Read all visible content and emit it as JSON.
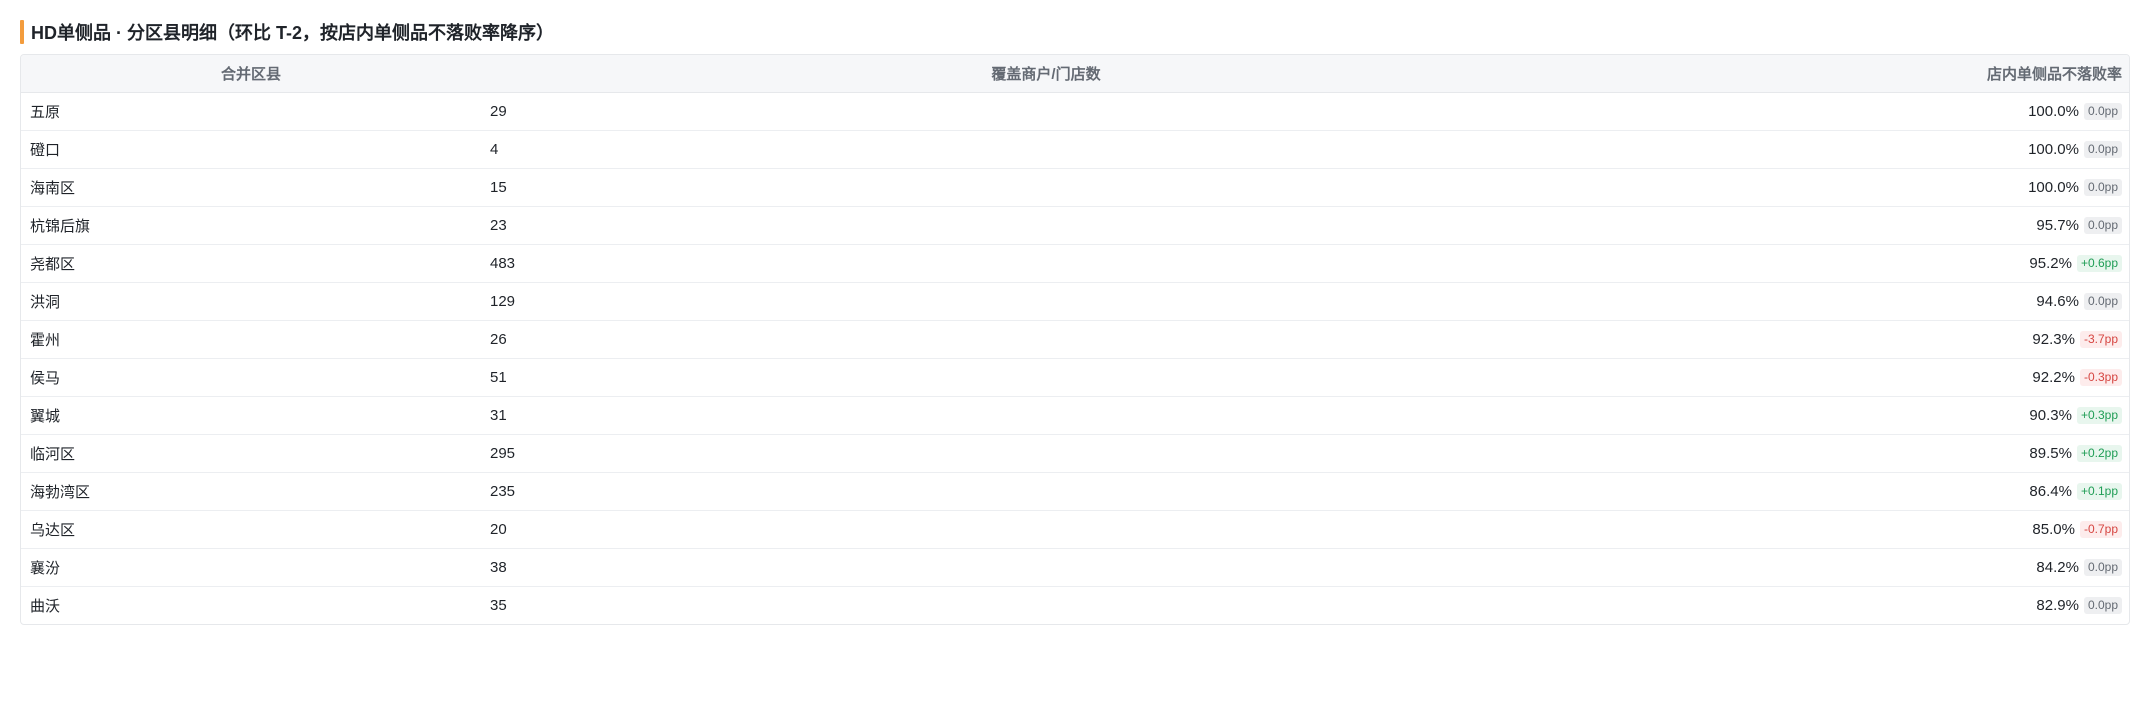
{
  "section": {
    "title": "HD单侧品 · 分区县明细（环比 T-2，按店内单侧品不落败率降序）"
  },
  "table": {
    "headers": {
      "region": "合并区县",
      "count": "覆盖商户/门店数",
      "rate": "店内单侧品不落败率"
    },
    "rows": [
      {
        "region": "五原",
        "count": "29",
        "rate": "100.0%",
        "delta": "0.0pp",
        "trend": "flat"
      },
      {
        "region": "磴口",
        "count": "4",
        "rate": "100.0%",
        "delta": "0.0pp",
        "trend": "flat"
      },
      {
        "region": "海南区",
        "count": "15",
        "rate": "100.0%",
        "delta": "0.0pp",
        "trend": "flat"
      },
      {
        "region": "杭锦后旗",
        "count": "23",
        "rate": "95.7%",
        "delta": "0.0pp",
        "trend": "flat"
      },
      {
        "region": "尧都区",
        "count": "483",
        "rate": "95.2%",
        "delta": "+0.6pp",
        "trend": "up"
      },
      {
        "region": "洪洞",
        "count": "129",
        "rate": "94.6%",
        "delta": "0.0pp",
        "trend": "flat"
      },
      {
        "region": "霍州",
        "count": "26",
        "rate": "92.3%",
        "delta": "-3.7pp",
        "trend": "down"
      },
      {
        "region": "侯马",
        "count": "51",
        "rate": "92.2%",
        "delta": "-0.3pp",
        "trend": "down"
      },
      {
        "region": "翼城",
        "count": "31",
        "rate": "90.3%",
        "delta": "+0.3pp",
        "trend": "up"
      },
      {
        "region": "临河区",
        "count": "295",
        "rate": "89.5%",
        "delta": "+0.2pp",
        "trend": "up"
      },
      {
        "region": "海勃湾区",
        "count": "235",
        "rate": "86.4%",
        "delta": "+0.1pp",
        "trend": "up"
      },
      {
        "region": "乌达区",
        "count": "20",
        "rate": "85.0%",
        "delta": "-0.7pp",
        "trend": "down"
      },
      {
        "region": "襄汾",
        "count": "38",
        "rate": "84.2%",
        "delta": "0.0pp",
        "trend": "flat"
      },
      {
        "region": "曲沃",
        "count": "35",
        "rate": "82.9%",
        "delta": "0.0pp",
        "trend": "flat"
      }
    ]
  },
  "colors": {
    "accent": "#f39c3d",
    "up": "#1f9d55",
    "down": "#d64541",
    "flat": "#646a73"
  }
}
